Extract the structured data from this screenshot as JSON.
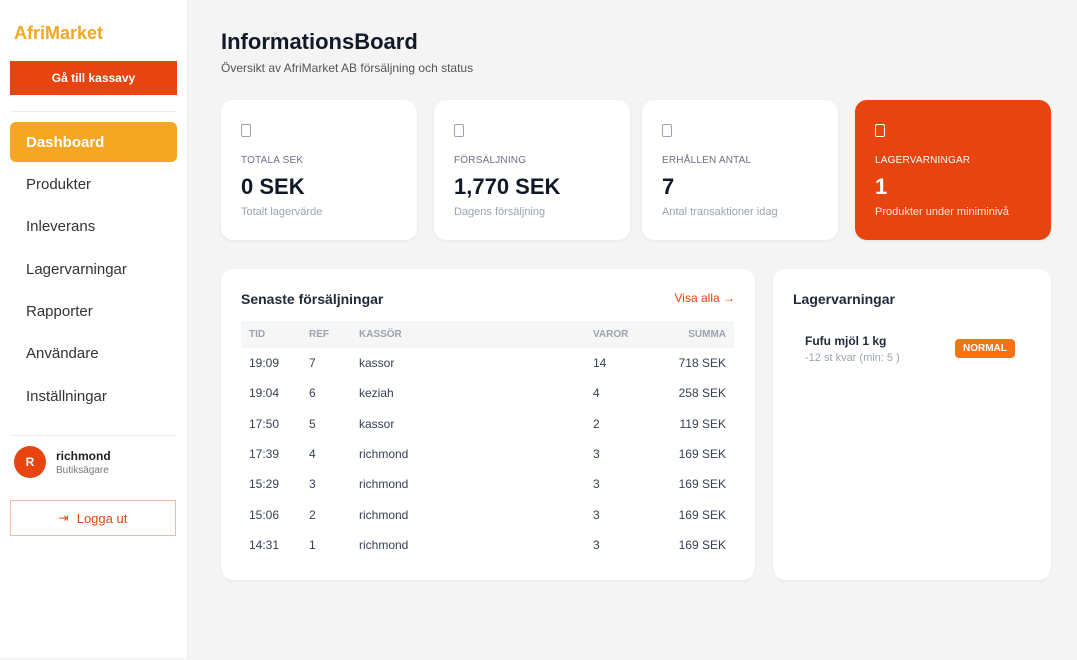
{
  "sidebar": {
    "brand": "AfriMarket",
    "pos_button": "Gå till kassavy",
    "nav": [
      "Dashboard",
      "Produkter",
      "Inleverans",
      "Lagervarningar",
      "Rapporter",
      "Användare",
      "Inställningar"
    ],
    "user": {
      "initial": "R",
      "name": "richmond",
      "role": "Butiksägare"
    },
    "logout_icon": "⇥",
    "logout": "Logga ut"
  },
  "header": {
    "title": "InformationsBoard",
    "subtitle": "Översikt av AfriMarket AB försäljning och status"
  },
  "stats": [
    {
      "label": "TOTALA SEK",
      "value": "0 SEK",
      "desc": "Totalt lagervärde"
    },
    {
      "label": "FÖRSÄLJNING",
      "value": "1,770 SEK",
      "desc": "Dagens försäljning"
    },
    {
      "label": "ERHÅLLEN ANTAL",
      "value": "7",
      "desc": "Antal transaktioner idag"
    },
    {
      "label": "LAGERVARNINGAR",
      "value": "1",
      "desc": "Produkter under miniminivå"
    }
  ],
  "sales": {
    "title": "Senaste försäljningar",
    "view_all": "Visa alla →",
    "columns": [
      "TID",
      "REF",
      "KASSÖR",
      "VAROR",
      "SUMMA"
    ],
    "rows": [
      [
        "19:09",
        "7",
        "kassor",
        "14",
        "718 SEK"
      ],
      [
        "19:04",
        "6",
        "keziah",
        "4",
        "258 SEK"
      ],
      [
        "17:50",
        "5",
        "kassor",
        "2",
        "119 SEK"
      ],
      [
        "17:39",
        "4",
        "richmond",
        "3",
        "169 SEK"
      ],
      [
        "15:29",
        "3",
        "richmond",
        "3",
        "169 SEK"
      ],
      [
        "15:06",
        "2",
        "richmond",
        "3",
        "169 SEK"
      ],
      [
        "14:31",
        "1",
        "richmond",
        "3",
        "169 SEK"
      ]
    ]
  },
  "stock": {
    "title": "Lagervarningar",
    "items": [
      {
        "name": "Fufu mjöl 1 kg",
        "sub": "-12 st kvar (min: 5 )",
        "badge": "NORMAL"
      }
    ]
  }
}
